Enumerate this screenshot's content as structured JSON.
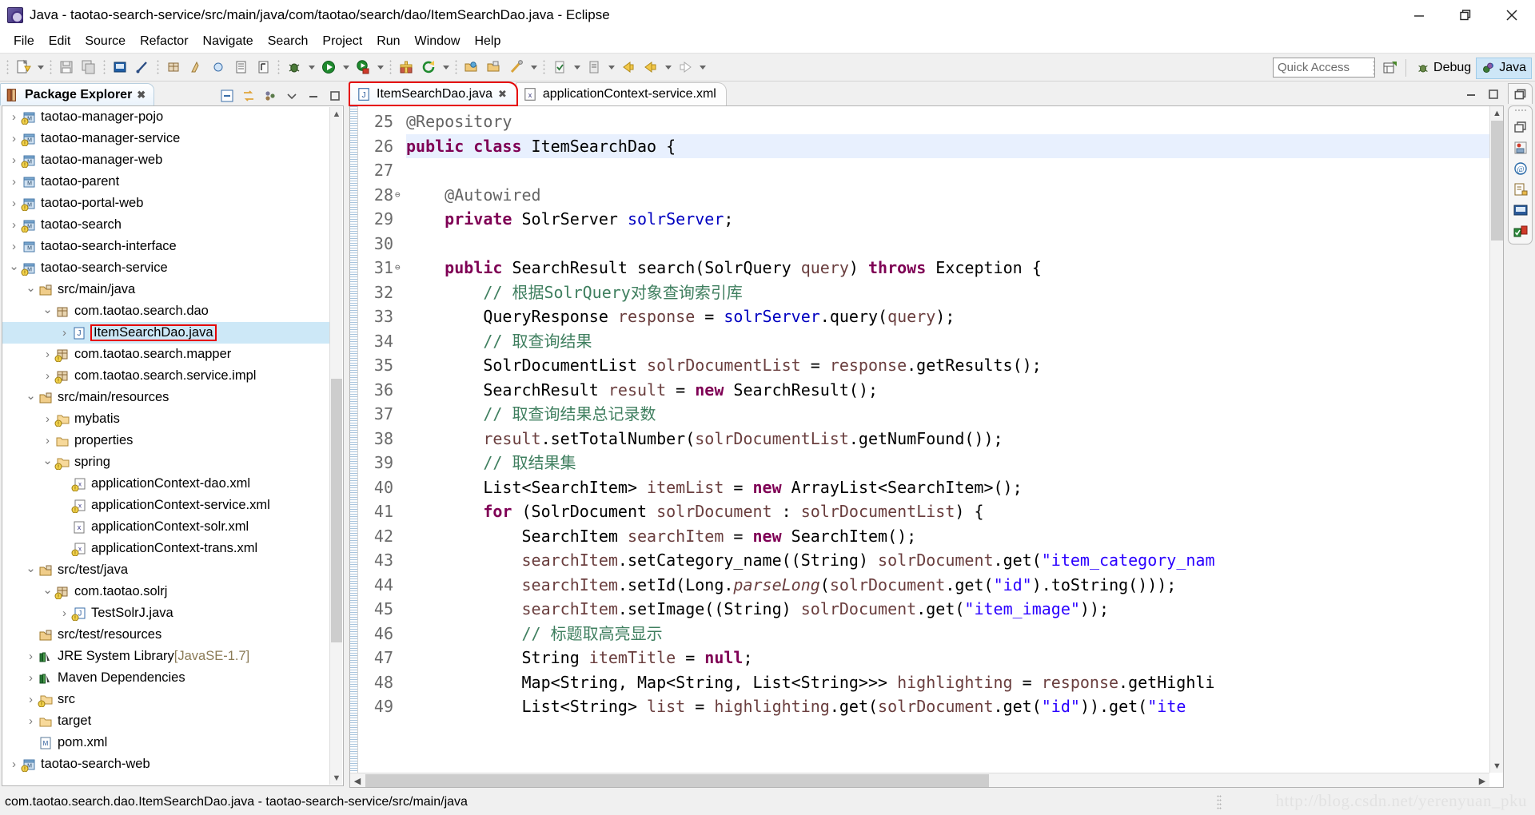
{
  "window": {
    "title": "Java - taotao-search-service/src/main/java/com/taotao/search/dao/ItemSearchDao.java - Eclipse",
    "app_icon": "eclipse-icon",
    "minimize_label": "Minimize",
    "restore_label": "Restore",
    "close_label": "Close"
  },
  "menubar": {
    "items": [
      {
        "label": "File"
      },
      {
        "label": "Edit"
      },
      {
        "label": "Source"
      },
      {
        "label": "Refactor"
      },
      {
        "label": "Navigate"
      },
      {
        "label": "Search"
      },
      {
        "label": "Project"
      },
      {
        "label": "Run"
      },
      {
        "label": "Window"
      },
      {
        "label": "Help"
      }
    ]
  },
  "toolbar": {
    "quick_access_placeholder": "Quick Access",
    "quick_access_value": "",
    "open_perspective_label": "Open Perspective",
    "perspectives": [
      {
        "label": "Debug",
        "icon": "debug-perspective-icon",
        "active": false
      },
      {
        "label": "Java",
        "icon": "java-perspective-icon",
        "active": true
      }
    ],
    "buttons": [
      {
        "name": "new-wizard",
        "icon": "new-file-icon"
      },
      {
        "name": "save",
        "icon": "save-icon"
      },
      {
        "name": "save-all",
        "icon": "save-all-icon"
      },
      {
        "name": "print",
        "icon": "print-icon"
      },
      {
        "name": "toggle-mark-occurrences",
        "icon": "pen-icon"
      },
      {
        "name": "new-java-package",
        "icon": "package-icon"
      },
      {
        "name": "new-java-class",
        "icon": "class-icon"
      },
      {
        "name": "new-java-interface",
        "icon": "interface-icon"
      },
      {
        "name": "open-type",
        "icon": "open-type-icon"
      },
      {
        "name": "open-task",
        "icon": "task-icon"
      },
      {
        "name": "debug",
        "icon": "debug-icon"
      },
      {
        "name": "run",
        "icon": "run-icon"
      },
      {
        "name": "run-last-tool",
        "icon": "run-tool-icon"
      },
      {
        "name": "new-package",
        "icon": "gift-icon"
      },
      {
        "name": "refresh",
        "icon": "refresh-icon"
      },
      {
        "name": "open-resource",
        "icon": "open-folder-icon"
      },
      {
        "name": "coverage",
        "icon": "coverage-icon"
      },
      {
        "name": "edit-marker",
        "icon": "marker-icon"
      },
      {
        "name": "next-annotation",
        "icon": "next-annotation-icon"
      },
      {
        "name": "previous-annotation",
        "icon": "prev-annotation-icon"
      },
      {
        "name": "back",
        "icon": "back-arrow-icon"
      },
      {
        "name": "forward",
        "icon": "forward-arrow-icon"
      }
    ]
  },
  "package_explorer": {
    "tab_label": "Package Explorer",
    "tab_close": "✖",
    "tools": [
      {
        "name": "collapse-all-button",
        "icon": "collapse-all-icon"
      },
      {
        "name": "link-with-editor-button",
        "icon": "link-editor-icon"
      },
      {
        "name": "view-menu-button",
        "icon": "view-menu-icon"
      },
      {
        "name": "minimize-view-button",
        "icon": "minimize-icon"
      },
      {
        "name": "maximize-view-button",
        "icon": "maximize-icon"
      }
    ],
    "tree": [
      {
        "label": "taotao-manager-pojo",
        "indent": 0,
        "twist": "collapsed",
        "icon": "maven-project-icon",
        "selected": false,
        "highlight": false
      },
      {
        "label": "taotao-manager-service",
        "indent": 0,
        "twist": "collapsed",
        "icon": "maven-project-icon",
        "selected": false,
        "highlight": false
      },
      {
        "label": "taotao-manager-web",
        "indent": 0,
        "twist": "collapsed",
        "icon": "maven-project-icon",
        "selected": false,
        "highlight": false
      },
      {
        "label": "taotao-parent",
        "indent": 0,
        "twist": "collapsed",
        "icon": "maven-project-plain-icon",
        "selected": false,
        "highlight": false
      },
      {
        "label": "taotao-portal-web",
        "indent": 0,
        "twist": "collapsed",
        "icon": "maven-project-icon",
        "selected": false,
        "highlight": false
      },
      {
        "label": "taotao-search",
        "indent": 0,
        "twist": "collapsed",
        "icon": "maven-project-icon",
        "selected": false,
        "highlight": false
      },
      {
        "label": "taotao-search-interface",
        "indent": 0,
        "twist": "collapsed",
        "icon": "maven-project-plain-icon",
        "selected": false,
        "highlight": false
      },
      {
        "label": "taotao-search-service",
        "indent": 0,
        "twist": "expanded",
        "icon": "maven-project-icon",
        "selected": false,
        "highlight": false
      },
      {
        "label": "src/main/java",
        "indent": 1,
        "twist": "expanded",
        "icon": "source-folder-icon",
        "selected": false,
        "highlight": false
      },
      {
        "label": "com.taotao.search.dao",
        "indent": 2,
        "twist": "expanded",
        "icon": "package-icon",
        "selected": false,
        "highlight": false
      },
      {
        "label": "ItemSearchDao.java",
        "indent": 3,
        "twist": "collapsed",
        "icon": "java-file-icon",
        "selected": true,
        "highlight": true
      },
      {
        "label": "com.taotao.search.mapper",
        "indent": 2,
        "twist": "collapsed",
        "icon": "package-warn-icon",
        "selected": false,
        "highlight": false
      },
      {
        "label": "com.taotao.search.service.impl",
        "indent": 2,
        "twist": "collapsed",
        "icon": "package-warn-icon",
        "selected": false,
        "highlight": false
      },
      {
        "label": "src/main/resources",
        "indent": 1,
        "twist": "expanded",
        "icon": "source-folder-icon",
        "selected": false,
        "highlight": false
      },
      {
        "label": "mybatis",
        "indent": 2,
        "twist": "collapsed",
        "icon": "folder-warn-icon",
        "selected": false,
        "highlight": false
      },
      {
        "label": "properties",
        "indent": 2,
        "twist": "collapsed",
        "icon": "folder-icon",
        "selected": false,
        "highlight": false
      },
      {
        "label": "spring",
        "indent": 2,
        "twist": "expanded",
        "icon": "folder-warn-icon",
        "selected": false,
        "highlight": false
      },
      {
        "label": "applicationContext-dao.xml",
        "indent": 3,
        "twist": "none",
        "icon": "xml-warn-icon",
        "selected": false,
        "highlight": false
      },
      {
        "label": "applicationContext-service.xml",
        "indent": 3,
        "twist": "none",
        "icon": "xml-warn-icon",
        "selected": false,
        "highlight": false
      },
      {
        "label": "applicationContext-solr.xml",
        "indent": 3,
        "twist": "none",
        "icon": "xml-icon",
        "selected": false,
        "highlight": false
      },
      {
        "label": "applicationContext-trans.xml",
        "indent": 3,
        "twist": "none",
        "icon": "xml-warn-icon",
        "selected": false,
        "highlight": false
      },
      {
        "label": "src/test/java",
        "indent": 1,
        "twist": "expanded",
        "icon": "source-folder-icon",
        "selected": false,
        "highlight": false
      },
      {
        "label": "com.taotao.solrj",
        "indent": 2,
        "twist": "expanded",
        "icon": "package-warn-icon",
        "selected": false,
        "highlight": false
      },
      {
        "label": "TestSolrJ.java",
        "indent": 3,
        "twist": "collapsed",
        "icon": "java-warn-file-icon",
        "selected": false,
        "highlight": false
      },
      {
        "label": "src/test/resources",
        "indent": 1,
        "twist": "none",
        "icon": "source-folder-icon",
        "selected": false,
        "highlight": false
      },
      {
        "label": "JRE System Library",
        "suffix": "[JavaSE-1.7]",
        "indent": 1,
        "twist": "collapsed",
        "icon": "library-icon",
        "selected": false,
        "highlight": false
      },
      {
        "label": "Maven Dependencies",
        "indent": 1,
        "twist": "collapsed",
        "icon": "library-icon",
        "selected": false,
        "highlight": false
      },
      {
        "label": "src",
        "indent": 1,
        "twist": "collapsed",
        "icon": "folder-warn-icon",
        "selected": false,
        "highlight": false
      },
      {
        "label": "target",
        "indent": 1,
        "twist": "collapsed",
        "icon": "folder-icon",
        "selected": false,
        "highlight": false
      },
      {
        "label": "pom.xml",
        "indent": 1,
        "twist": "none",
        "icon": "pom-icon",
        "selected": false,
        "highlight": false
      },
      {
        "label": "taotao-search-web",
        "indent": 0,
        "twist": "collapsed",
        "icon": "maven-project-icon",
        "selected": false,
        "highlight": false
      }
    ]
  },
  "editor": {
    "tabs": [
      {
        "label": "ItemSearchDao.java",
        "icon": "java-file-icon",
        "active": true,
        "closeable": true,
        "highlight": true
      },
      {
        "label": "applicationContext-service.xml",
        "icon": "xml-icon",
        "active": false,
        "closeable": false,
        "highlight": false
      }
    ],
    "tools": [
      {
        "name": "minimize-editor-button",
        "icon": "minimize-icon"
      },
      {
        "name": "maximize-editor-button",
        "icon": "maximize-icon"
      }
    ],
    "first_line": 25,
    "highlighted_line": 26,
    "folding_lines": [
      28,
      31
    ],
    "lines": [
      {
        "no": 25,
        "text": "@Repository",
        "html": "<span class=\"ann\">@Repository</span>"
      },
      {
        "no": 26,
        "text": "public class ItemSearchDao {",
        "html": "<span class=\"kw\">public class</span> ItemSearchDao {"
      },
      {
        "no": 27,
        "text": "",
        "html": ""
      },
      {
        "no": 28,
        "text": "    @Autowired",
        "html": "    <span class=\"ann\">@Autowired</span>"
      },
      {
        "no": 29,
        "text": "    private SolrServer solrServer;",
        "html": "    <span class=\"kw\">private</span> SolrServer <span class=\"fld\">solrServer</span>;"
      },
      {
        "no": 30,
        "text": "",
        "html": ""
      },
      {
        "no": 31,
        "text": "    public SearchResult search(SolrQuery query) throws Exception {",
        "html": "    <span class=\"kw\">public</span> SearchResult search(SolrQuery <span class=\"par\">query</span>) <span class=\"kw\">throws</span> Exception {"
      },
      {
        "no": 32,
        "text": "        // 根据SolrQuery对象查询索引库",
        "html": "        <span class=\"cmt\">// 根据SolrQuery对象查询索引库</span>"
      },
      {
        "no": 33,
        "text": "        QueryResponse response = solrServer.query(query);",
        "html": "        QueryResponse <span class=\"par\">response</span> = <span class=\"fld\">solrServer</span>.query(<span class=\"par\">query</span>);"
      },
      {
        "no": 34,
        "text": "        // 取查询结果",
        "html": "        <span class=\"cmt\">// 取查询结果</span>"
      },
      {
        "no": 35,
        "text": "        SolrDocumentList solrDocumentList = response.getResults();",
        "html": "        SolrDocumentList <span class=\"par\">solrDocumentList</span> = <span class=\"par\">response</span>.getResults();"
      },
      {
        "no": 36,
        "text": "        SearchResult result = new SearchResult();",
        "html": "        SearchResult <span class=\"par\">result</span> = <span class=\"kw\">new</span> SearchResult();"
      },
      {
        "no": 37,
        "text": "        // 取查询结果总记录数",
        "html": "        <span class=\"cmt\">// 取查询结果总记录数</span>"
      },
      {
        "no": 38,
        "text": "        result.setTotalNumber(solrDocumentList.getNumFound());",
        "html": "        <span class=\"par\">result</span>.setTotalNumber(<span class=\"par\">solrDocumentList</span>.getNumFound());"
      },
      {
        "no": 39,
        "text": "        // 取结果集",
        "html": "        <span class=\"cmt\">// 取结果集</span>"
      },
      {
        "no": 40,
        "text": "        List<SearchItem> itemList = new ArrayList<SearchItem>();",
        "html": "        List&lt;SearchItem&gt; <span class=\"par\">itemList</span> = <span class=\"kw\">new</span> ArrayList&lt;SearchItem&gt;();"
      },
      {
        "no": 41,
        "text": "        for (SolrDocument solrDocument : solrDocumentList) {",
        "html": "        <span class=\"kw\">for</span> (SolrDocument <span class=\"par\">solrDocument</span> : <span class=\"par\">solrDocumentList</span>) {"
      },
      {
        "no": 42,
        "text": "            SearchItem searchItem = new SearchItem();",
        "html": "            SearchItem <span class=\"par\">searchItem</span> = <span class=\"kw\">new</span> SearchItem();"
      },
      {
        "no": 43,
        "text": "            searchItem.setCategory_name((String) solrDocument.get(\"item_category_nam",
        "html": "            <span class=\"par\">searchItem</span>.setCategory_name((String) <span class=\"par\">solrDocument</span>.get(<span class=\"str\">\"item_category_nam</span>"
      },
      {
        "no": 44,
        "text": "            searchItem.setId(Long.parseLong(solrDocument.get(\"id\").toString()));",
        "html": "            <span class=\"par\">searchItem</span>.setId(Long.<span class=\"ital\">parseLong</span>(<span class=\"par\">solrDocument</span>.get(<span class=\"str\">\"id\"</span>).toString()));"
      },
      {
        "no": 45,
        "text": "            searchItem.setImage((String) solrDocument.get(\"item_image\"));",
        "html": "            <span class=\"par\">searchItem</span>.setImage((String) <span class=\"par\">solrDocument</span>.get(<span class=\"str\">\"item_image\"</span>));"
      },
      {
        "no": 46,
        "text": "            // 标题取高亮显示",
        "html": "            <span class=\"cmt\">// 标题取高亮显示</span>"
      },
      {
        "no": 47,
        "text": "            String itemTitle = null;",
        "html": "            String <span class=\"par\">itemTitle</span> = <span class=\"kw\">null</span>;"
      },
      {
        "no": 48,
        "text": "            Map<String, Map<String, List<String>>> highlighting = response.getHighli",
        "html": "            Map&lt;String, Map&lt;String, List&lt;String&gt;&gt;&gt; <span class=\"par\">highlighting</span> = <span class=\"par\">response</span>.getHighli"
      },
      {
        "no": 49,
        "text": "            List<String> list = highlighting.get(solrDocument.get(\"id\")).get(\"ite",
        "html": "            List&lt;String&gt; <span class=\"par\">list</span> = <span class=\"par\">highlighting</span>.get(<span class=\"par\">solrDocument</span>.get(<span class=\"str\">\"id\"</span>)).get(<span class=\"str\">\"ite</span>"
      }
    ]
  },
  "rightbar": {
    "icons": [
      {
        "name": "restore-view-icon"
      },
      {
        "name": "outline-view-icon"
      },
      {
        "name": "javadoc-view-icon"
      },
      {
        "name": "declaration-view-icon"
      },
      {
        "name": "console-view-icon"
      },
      {
        "name": "junit-view-icon"
      }
    ]
  },
  "statusbar": {
    "text": "com.taotao.search.dao.ItemSearchDao.java - taotao-search-service/src/main/java",
    "watermark": "http://blog.csdn.net/yerenyuan_pku"
  }
}
